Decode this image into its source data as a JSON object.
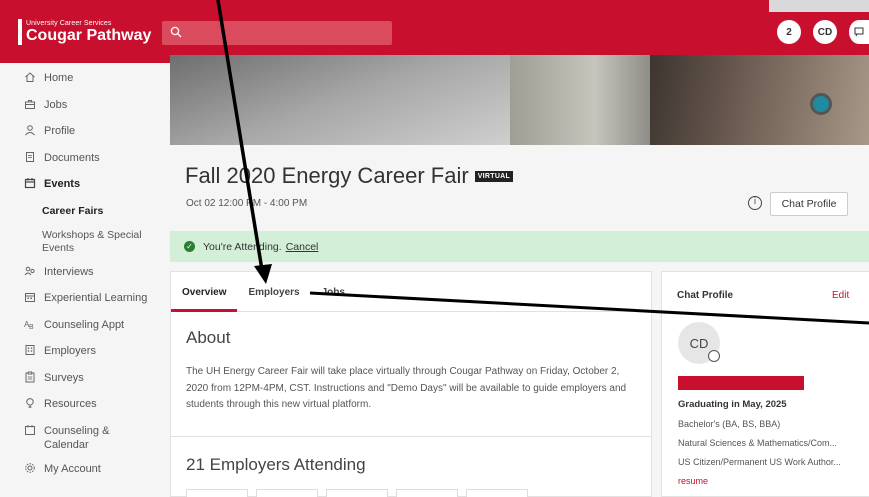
{
  "header": {
    "logo_small": "University Career Services",
    "logo_big": "Cougar Pathway",
    "notifications_count": "2",
    "user_initials": "CD"
  },
  "sidebar": {
    "items": [
      {
        "label": "Home",
        "icon": "home-icon"
      },
      {
        "label": "Jobs",
        "icon": "briefcase-icon"
      },
      {
        "label": "Profile",
        "icon": "person-icon"
      },
      {
        "label": "Documents",
        "icon": "document-icon"
      },
      {
        "label": "Events",
        "icon": "calendar-icon"
      },
      {
        "label": "Career Fairs"
      },
      {
        "label": "Workshops & Special Events"
      },
      {
        "label": "Interviews",
        "icon": "people-icon"
      },
      {
        "label": "Experiential Learning",
        "icon": "calendar-grid-icon"
      },
      {
        "label": "Counseling Appt",
        "icon": "counseling-icon"
      },
      {
        "label": "Employers",
        "icon": "building-icon"
      },
      {
        "label": "Surveys",
        "icon": "clipboard-icon"
      },
      {
        "label": "Resources",
        "icon": "lightbulb-icon"
      },
      {
        "label": "Counseling & Calendar",
        "icon": "calendar-outline-icon"
      },
      {
        "label": "My Account",
        "icon": "gear-icon"
      }
    ]
  },
  "event": {
    "title": "Fall 2020 Energy Career Fair",
    "badge": "VIRTUAL",
    "date": "Oct 02 12:00 PM - 4:00 PM",
    "chat_profile_button": "Chat Profile",
    "attending_text": "You're Attending.",
    "cancel_label": "Cancel"
  },
  "tabs": [
    {
      "label": "Overview",
      "active": true
    },
    {
      "label": "Employers",
      "active": false
    },
    {
      "label": "Jobs",
      "active": false
    }
  ],
  "about": {
    "title": "About",
    "text": "The UH Energy Career Fair will take place virtually through Cougar Pathway on Friday, October 2, 2020 from 12PM-4PM, CST. Instructions and \"Demo Days\" will be available to guide employers and students through this new virtual platform."
  },
  "employers_attending": "21 Employers Attending",
  "chat_profile": {
    "title": "Chat Profile",
    "edit_label": "Edit",
    "avatar_initials": "CD",
    "graduating": "Graduating in May, 2025",
    "degree": "Bachelor's (BA, BS, BBA)",
    "college": "Natural Sciences & Mathematics/Com...",
    "citizenship": "US Citizen/Permanent US Work Author...",
    "resume_label": "resume"
  },
  "colors": {
    "brand_red": "#c8102e",
    "attending_bg": "#d3efd7",
    "success_green": "#2e7d32"
  }
}
